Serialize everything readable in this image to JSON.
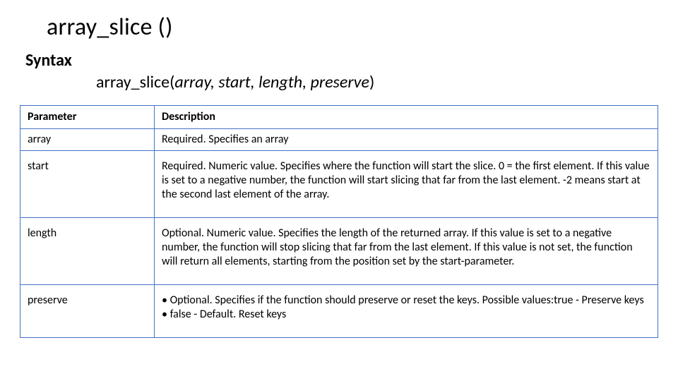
{
  "title": "array_slice ()",
  "syntax": {
    "label": "Syntax",
    "fn": "array_slice(",
    "args": "array, start, length, preserve",
    "close": ")"
  },
  "table": {
    "headers": {
      "param": "Parameter",
      "desc": "Description"
    },
    "rows": [
      {
        "param": "array",
        "desc": "Required. Specifies an array",
        "tall": false
      },
      {
        "param": "start",
        "desc": "Required. Numeric value. Specifies where the function will start the slice. 0 = the first element. If this value is set to a negative number, the function will start slicing that far from the last element. -2 means start at the second last element of the array.",
        "tall": true
      },
      {
        "param": "length",
        "desc": "Optional. Numeric value. Specifies the length of the returned array. If this value is set to a negative number, the function will stop slicing that far from the last element. If this value is not set, the function will return all elements, starting from the position set by the start-parameter.",
        "tall": true
      },
      {
        "param": "preserve",
        "desc_lines": [
          "• Optional. Specifies if the function should preserve or reset the keys. Possible values:true -  Preserve keys",
          "• false - Default. Reset keys"
        ],
        "tall": true
      }
    ]
  }
}
